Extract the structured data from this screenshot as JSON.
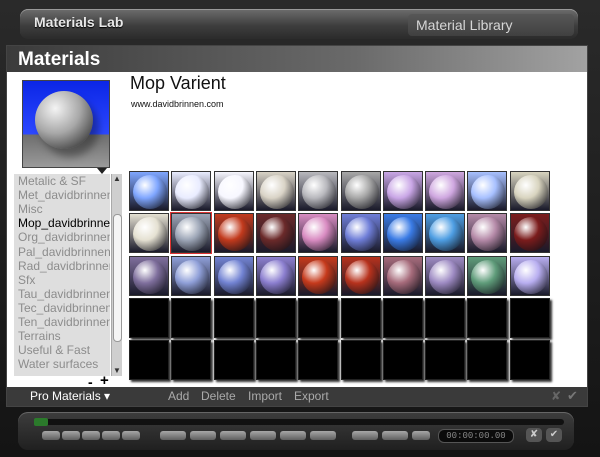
{
  "app": {
    "title": "Materials Lab",
    "library_tab": "Material Library"
  },
  "panel": {
    "title": "Materials"
  },
  "material": {
    "name": "Mop Varient",
    "url": "www.davidbrinnen.com"
  },
  "categories": [
    "Metalic & SF",
    "Met_davidbrinnen",
    "Misc",
    "Mop_davidbrinnen",
    "Org_davidbrinnen",
    "Pal_davidbrinnen",
    "Rad_davidbrinnen",
    "Sfx",
    "Tau_davidbrinnen",
    "Tec_davidbrinnen",
    "Ten_davidbrinnen",
    "Terrains",
    "Useful & Fast",
    "Water surfaces"
  ],
  "selected_category": "Mop_davidbrinnen",
  "list_controls": {
    "minus": "-",
    "plus": "+"
  },
  "swatch_colors": [
    [
      "#7fa6ff",
      "#e9ecff",
      "#f7f7ff",
      "#d9d3c6",
      "#b8b8bd",
      "#a7a7a7",
      "#c9a6e6",
      "#cfa7e0",
      "#a7c0ff",
      "#d8d4bf"
    ],
    [
      "#e5e1d2",
      "#9da6b7",
      "#c23a1d",
      "#6b2a2a",
      "#d98cc2",
      "#6f7ed8",
      "#3a7be5",
      "#4e9ee3",
      "#b58aa8",
      "#7b1c1c"
    ],
    [
      "#7f6f9d",
      "#8f9fd8",
      "#7283d3",
      "#8c7fd0",
      "#c63a1c",
      "#b7321d",
      "#a66b7b",
      "#9e8bc3",
      "#5f9c7a",
      "#b8aef0"
    ]
  ],
  "selected_swatch": {
    "row": 1,
    "col": 1
  },
  "empty_rows": 2,
  "bottom_bar": {
    "library_menu": "Pro Materials ▾",
    "add": "Add",
    "delete": "Delete",
    "import": "Import",
    "export": "Export",
    "close": "✘",
    "ok": "✔"
  },
  "timeline": {
    "time_display": "00:00:00.00",
    "close": "✘",
    "ok": "✔"
  }
}
